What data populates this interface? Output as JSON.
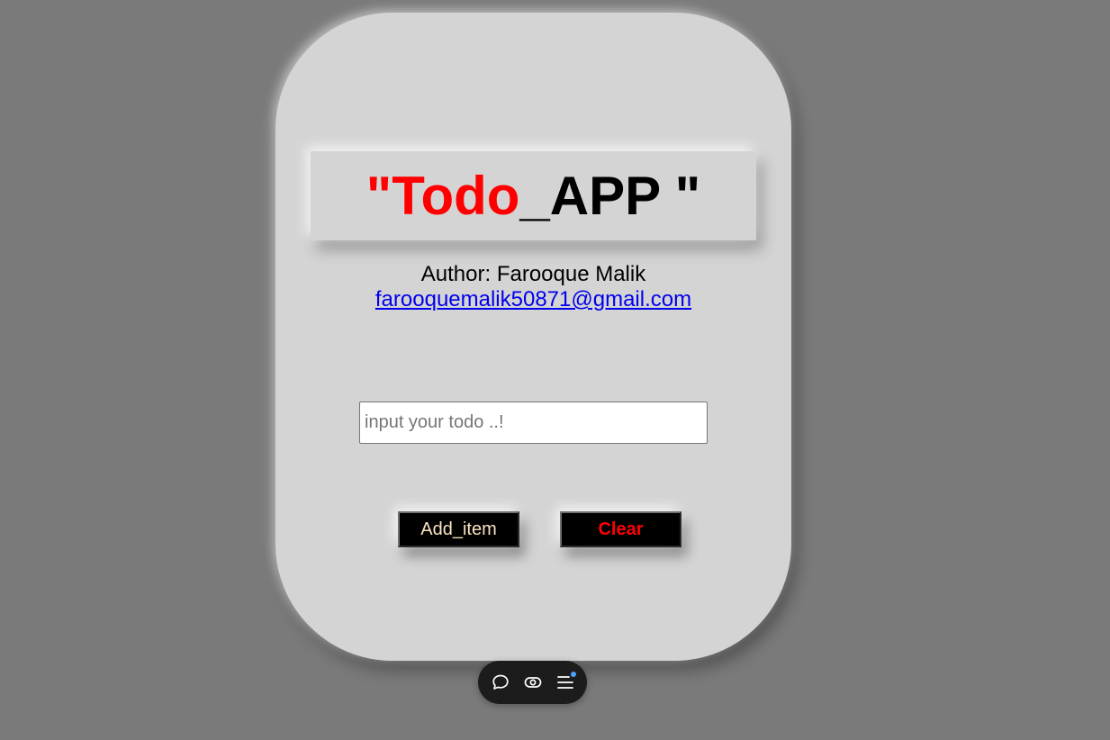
{
  "title": {
    "open_quote": "\" ",
    "todo": "Todo",
    "suffix": "_APP \""
  },
  "author_line": "Author: Farooque Malik",
  "email": "farooquemalik50871@gmail.com",
  "todo_input": {
    "placeholder": "input your todo ..!",
    "value": ""
  },
  "buttons": {
    "add_label": "Add_item",
    "clear_label": "Clear"
  },
  "toolbar": {
    "icons": [
      "chat-bubble-icon",
      "eye-icon",
      "menu-list-icon"
    ],
    "notification_color": "#4aa3ff"
  },
  "colors": {
    "background": "#7a7a7a",
    "card": "#d4d4d4",
    "title_red": "#ff0000",
    "link_blue": "#0000ee",
    "add_text": "#fbe3c2",
    "clear_text": "#ff0000"
  }
}
